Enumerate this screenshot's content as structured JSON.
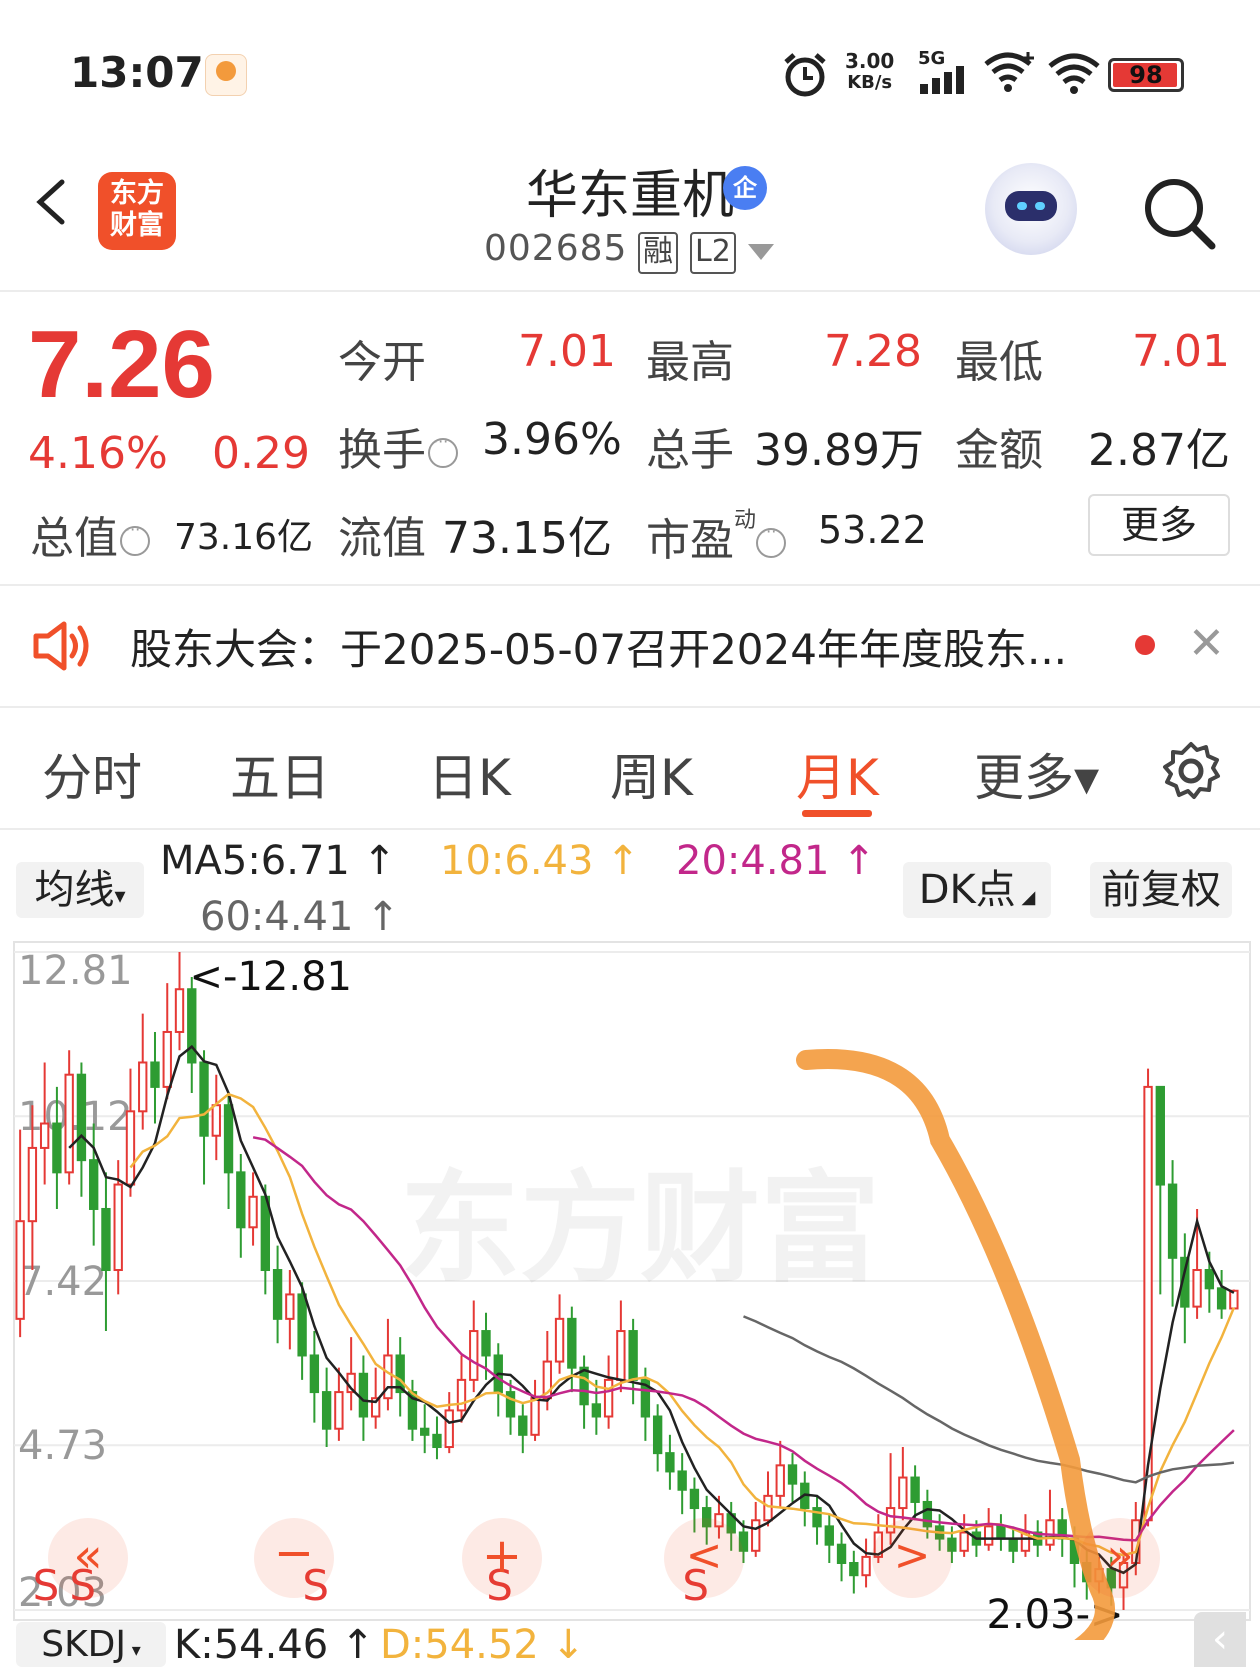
{
  "status_bar": {
    "time": "13:07",
    "net_speed": "3.00",
    "net_unit": "KB/s",
    "signal": "5G",
    "battery": "98"
  },
  "header": {
    "logo_line1": "东方",
    "logo_line2": "财富",
    "stock_name": "华东重机",
    "badge": "企",
    "code": "002685",
    "tag1": "融",
    "tag2": "L2"
  },
  "quote": {
    "price": "7.26",
    "change_pct": "4.16%",
    "change": "0.29",
    "open_label": "今开",
    "open": "7.01",
    "high_label": "最高",
    "high": "7.28",
    "low_label": "最低",
    "low": "7.01",
    "turnover_label": "换手",
    "turnover": "3.96%",
    "volume_label": "总手",
    "volume": "39.89万",
    "amount_label": "金额",
    "amount": "2.87亿",
    "mktcap_label": "总值",
    "mktcap": "73.16亿",
    "float_label": "流值",
    "float": "73.15亿",
    "pe_label": "市盈",
    "pe_sup": "动",
    "pe": "53.22",
    "more": "更多"
  },
  "notice": {
    "text": "股东大会：于2025-05-07召开2024年年度股东..."
  },
  "tabs": [
    "分时",
    "五日",
    "日K",
    "周K",
    "月K",
    "更多▾"
  ],
  "active_tab": 4,
  "indicators": {
    "ma_select": "均线",
    "ma5": "MA5:6.71",
    "ma10": "10:6.43",
    "ma20": "20:4.81",
    "ma60": "60:4.41",
    "dk": "DK点",
    "adjust": "前复权",
    "bottom_select": "SKDJ",
    "k": "K:54.46",
    "d": "D:54.52"
  },
  "chart_data": {
    "type": "candlestick",
    "y_labels": [
      "12.81",
      "10.12",
      "7.42",
      "4.73",
      "2.03"
    ],
    "ylim": [
      2.03,
      12.81
    ],
    "max_annotation": "<-12.81",
    "min_annotation": "2.03->",
    "watermark": "东方财富",
    "signal_letters": [
      "S",
      "S",
      "S",
      "S",
      "S"
    ],
    "candles": [
      [
        6.8,
        8.4,
        9.9,
        6.5
      ],
      [
        8.4,
        9.6,
        10.3,
        7.6
      ],
      [
        9.6,
        10.0,
        11.0,
        9.0
      ],
      [
        10.0,
        9.2,
        10.6,
        8.6
      ],
      [
        9.2,
        10.8,
        11.2,
        9.0
      ],
      [
        10.8,
        9.4,
        11.0,
        8.8
      ],
      [
        9.4,
        8.6,
        10.0,
        8.0
      ],
      [
        8.6,
        7.6,
        9.2,
        6.6
      ],
      [
        7.6,
        9.0,
        9.4,
        7.2
      ],
      [
        9.0,
        10.2,
        10.9,
        8.8
      ],
      [
        10.2,
        11.0,
        11.8,
        9.9
      ],
      [
        11.0,
        10.6,
        11.5,
        10.0
      ],
      [
        10.6,
        11.5,
        12.3,
        10.4
      ],
      [
        11.5,
        12.2,
        12.81,
        11.2
      ],
      [
        12.2,
        11.0,
        12.4,
        10.5
      ],
      [
        11.0,
        9.8,
        11.2,
        9.0
      ],
      [
        9.8,
        10.3,
        10.8,
        9.4
      ],
      [
        10.3,
        9.2,
        10.5,
        8.6
      ],
      [
        9.2,
        8.3,
        9.5,
        7.8
      ],
      [
        8.3,
        8.8,
        9.2,
        8.0
      ],
      [
        8.8,
        7.6,
        9.0,
        7.2
      ],
      [
        7.6,
        6.8,
        8.0,
        6.4
      ],
      [
        6.8,
        7.2,
        7.6,
        6.3
      ],
      [
        7.2,
        6.2,
        7.4,
        5.8
      ],
      [
        6.2,
        5.6,
        6.6,
        5.1
      ],
      [
        5.6,
        5.0,
        6.0,
        4.7
      ],
      [
        5.0,
        5.6,
        6.0,
        4.8
      ],
      [
        5.6,
        5.9,
        6.5,
        5.3
      ],
      [
        5.9,
        5.2,
        6.2,
        4.8
      ],
      [
        5.2,
        5.5,
        6.0,
        5.0
      ],
      [
        5.5,
        6.2,
        6.8,
        5.3
      ],
      [
        6.2,
        5.6,
        6.5,
        5.2
      ],
      [
        5.6,
        5.0,
        5.8,
        4.8
      ],
      [
        5.0,
        4.9,
        5.4,
        4.6
      ],
      [
        4.9,
        4.7,
        5.2,
        4.5
      ],
      [
        4.7,
        5.3,
        5.6,
        4.6
      ],
      [
        5.3,
        5.8,
        6.2,
        5.1
      ],
      [
        5.8,
        6.6,
        7.1,
        5.6
      ],
      [
        6.6,
        6.2,
        6.9,
        5.8
      ],
      [
        6.2,
        5.6,
        6.4,
        5.2
      ],
      [
        5.6,
        5.2,
        5.8,
        4.9
      ],
      [
        5.2,
        4.9,
        5.4,
        4.6
      ],
      [
        4.9,
        5.5,
        5.8,
        4.8
      ],
      [
        5.5,
        6.1,
        6.6,
        5.3
      ],
      [
        6.1,
        6.8,
        7.2,
        5.9
      ],
      [
        6.8,
        6.0,
        7.0,
        5.6
      ],
      [
        6.0,
        5.4,
        6.2,
        5.0
      ],
      [
        5.4,
        5.2,
        5.8,
        4.9
      ],
      [
        5.2,
        5.8,
        6.2,
        5.0
      ],
      [
        5.8,
        6.6,
        7.1,
        5.6
      ],
      [
        6.6,
        5.8,
        6.8,
        5.4
      ],
      [
        5.8,
        5.2,
        6.0,
        4.8
      ],
      [
        5.2,
        4.6,
        5.4,
        4.3
      ],
      [
        4.6,
        4.3,
        4.9,
        4.0
      ],
      [
        4.3,
        4.0,
        4.6,
        3.6
      ],
      [
        4.0,
        3.7,
        4.2,
        3.3
      ],
      [
        3.7,
        3.4,
        3.9,
        3.1
      ],
      [
        3.4,
        3.6,
        3.9,
        3.2
      ],
      [
        3.6,
        3.3,
        3.8,
        3.0
      ],
      [
        3.3,
        3.0,
        3.5,
        2.8
      ],
      [
        3.0,
        3.5,
        3.8,
        2.9
      ],
      [
        3.5,
        3.9,
        4.3,
        3.4
      ],
      [
        3.9,
        4.4,
        4.8,
        3.7
      ],
      [
        4.4,
        4.1,
        4.6,
        3.8
      ],
      [
        4.1,
        3.7,
        4.3,
        3.4
      ],
      [
        3.7,
        3.4,
        3.9,
        3.1
      ],
      [
        3.4,
        3.1,
        3.6,
        2.8
      ],
      [
        3.1,
        2.8,
        3.3,
        2.5
      ],
      [
        2.8,
        2.6,
        3.0,
        2.3
      ],
      [
        2.6,
        2.9,
        3.2,
        2.4
      ],
      [
        2.9,
        3.3,
        3.6,
        2.8
      ],
      [
        3.3,
        3.7,
        4.6,
        3.1
      ],
      [
        3.7,
        4.2,
        4.7,
        3.5
      ],
      [
        4.2,
        3.8,
        4.4,
        3.5
      ],
      [
        3.8,
        3.4,
        4.0,
        3.2
      ],
      [
        3.4,
        3.2,
        3.6,
        3.0
      ],
      [
        3.2,
        3.0,
        3.4,
        2.8
      ],
      [
        3.0,
        3.3,
        3.6,
        2.9
      ],
      [
        3.3,
        3.1,
        3.5,
        2.9
      ],
      [
        3.1,
        3.4,
        3.7,
        3.0
      ],
      [
        3.4,
        3.2,
        3.6,
        3.0
      ],
      [
        3.2,
        3.0,
        3.4,
        2.8
      ],
      [
        3.0,
        3.3,
        3.6,
        2.9
      ],
      [
        3.3,
        3.1,
        3.5,
        2.9
      ],
      [
        3.1,
        3.5,
        4.0,
        3.0
      ],
      [
        3.5,
        3.2,
        3.7,
        2.9
      ],
      [
        3.2,
        2.8,
        3.4,
        2.4
      ],
      [
        2.8,
        2.5,
        3.0,
        2.2
      ],
      [
        2.5,
        2.7,
        2.9,
        2.3
      ],
      [
        2.7,
        2.4,
        2.9,
        2.1
      ],
      [
        2.4,
        2.8,
        3.0,
        2.03
      ],
      [
        2.8,
        3.5,
        3.8,
        2.6
      ],
      [
        3.5,
        10.6,
        10.9,
        3.4
      ],
      [
        10.6,
        9.0,
        10.3,
        7.2
      ],
      [
        9.0,
        7.8,
        9.4,
        7.0
      ],
      [
        7.8,
        7.0,
        8.2,
        6.4
      ],
      [
        7.0,
        7.6,
        8.6,
        6.8
      ],
      [
        7.6,
        7.3,
        7.9,
        6.9
      ],
      [
        7.3,
        6.97,
        7.6,
        6.8
      ],
      [
        6.97,
        7.26,
        7.28,
        7.01
      ]
    ]
  }
}
